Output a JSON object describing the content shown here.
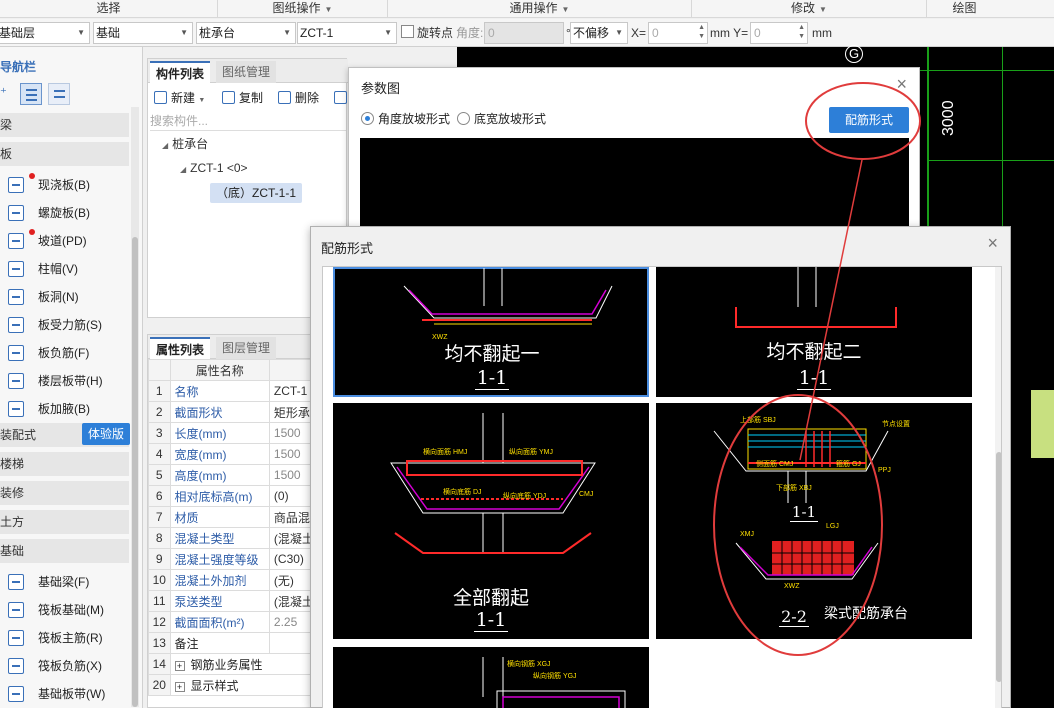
{
  "ribbon": {
    "groups": [
      "选择",
      "图纸操作",
      "通用操作",
      "修改",
      "绘图"
    ]
  },
  "selectors": {
    "floor": "基础层",
    "category": "基础",
    "type": "桩承台",
    "component": "ZCT-1",
    "rotate_label": "旋转点",
    "angle_label": "角度:",
    "angle_value": "0",
    "degree": "°",
    "offset_option": "不偏移",
    "x_label": "X=",
    "x_value": "0",
    "mm_y": "mm Y=",
    "y_value": "0",
    "mm": "mm"
  },
  "nav": {
    "title": "导航栏",
    "trial_badge": "体验版",
    "items": [
      {
        "kind": "cat",
        "label": "梁"
      },
      {
        "kind": "cat",
        "label": "板"
      },
      {
        "kind": "item",
        "label": "现浇板(B)",
        "dot": true
      },
      {
        "kind": "item",
        "label": "螺旋板(B)"
      },
      {
        "kind": "item",
        "label": "坡道(PD)",
        "dot": true
      },
      {
        "kind": "item",
        "label": "柱帽(V)"
      },
      {
        "kind": "item",
        "label": "板洞(N)"
      },
      {
        "kind": "item",
        "label": "板受力筋(S)"
      },
      {
        "kind": "item",
        "label": "板负筋(F)"
      },
      {
        "kind": "item",
        "label": "楼层板带(H)"
      },
      {
        "kind": "item",
        "label": "板加腋(B)"
      },
      {
        "kind": "cat",
        "label": "装配式"
      },
      {
        "kind": "cat",
        "label": "楼梯"
      },
      {
        "kind": "cat",
        "label": "装修"
      },
      {
        "kind": "cat",
        "label": "土方"
      },
      {
        "kind": "cat",
        "label": "基础"
      },
      {
        "kind": "item",
        "label": "基础梁(F)"
      },
      {
        "kind": "item",
        "label": "筏板基础(M)"
      },
      {
        "kind": "item",
        "label": "筏板主筋(R)"
      },
      {
        "kind": "item",
        "label": "筏板负筋(X)"
      },
      {
        "kind": "item",
        "label": "基础板带(W)"
      }
    ]
  },
  "component_panel": {
    "tab_list": "构件列表",
    "tab_drawing": "图纸管理",
    "new": "新建",
    "copy": "复制",
    "delete": "删除",
    "search_placeholder": "搜索构件...",
    "tree": [
      "桩承台",
      "ZCT-1 <0>",
      "（底）ZCT-1-1"
    ]
  },
  "property_panel": {
    "tab_props": "属性列表",
    "tab_layers": "图层管理",
    "header_name": "属性名称",
    "rows": [
      {
        "n": "1",
        "k": "名称",
        "v": "ZCT-1",
        "blue": true
      },
      {
        "n": "2",
        "k": "截面形状",
        "v": "矩形承",
        "blue": true
      },
      {
        "n": "3",
        "k": "长度(mm)",
        "v": "1500",
        "blue": true,
        "grey": true
      },
      {
        "n": "4",
        "k": "宽度(mm)",
        "v": "1500",
        "blue": true,
        "grey": true
      },
      {
        "n": "5",
        "k": "高度(mm)",
        "v": "1500",
        "blue": true,
        "grey": true
      },
      {
        "n": "6",
        "k": "相对底标高(m)",
        "v": "(0)",
        "blue": true
      },
      {
        "n": "7",
        "k": "材质",
        "v": "商品混",
        "blue": true
      },
      {
        "n": "8",
        "k": "混凝土类型",
        "v": "(混凝土",
        "blue": true
      },
      {
        "n": "9",
        "k": "混凝土强度等级",
        "v": "(C30)",
        "blue": true
      },
      {
        "n": "10",
        "k": "混凝土外加剂",
        "v": "(无)",
        "blue": true
      },
      {
        "n": "11",
        "k": "泵送类型",
        "v": "(混凝土",
        "blue": true
      },
      {
        "n": "12",
        "k": "截面面积(m²)",
        "v": "2.25",
        "blue": true,
        "grey": true
      },
      {
        "n": "13",
        "k": "备注",
        "v": ""
      },
      {
        "n": "14",
        "k": "钢筋业务属性",
        "v": "",
        "plus": true
      },
      {
        "n": "20",
        "k": "显示样式",
        "v": "",
        "plus": true
      }
    ]
  },
  "canvas": {
    "axis_label": "G",
    "dimension": "3000"
  },
  "param_dialog": {
    "title": "参数图",
    "radio_angle": "角度放坡形式",
    "radio_width": "底宽放坡形式",
    "button": "配筋形式"
  },
  "rebar_dialog": {
    "title": "配筋形式",
    "cards": [
      {
        "caption": "均不翻起一",
        "section": "1-1"
      },
      {
        "caption": "均不翻起二",
        "section": "1-1"
      },
      {
        "caption": "全部翻起",
        "section": "1-1"
      },
      {
        "caption": "梁式配筋承台",
        "section_a": "1-1",
        "section_b": "2-2"
      }
    ],
    "annotations": {
      "top_steel": "上部筋 SBJ",
      "side_steel": "侧面筋 CMJ",
      "bottom_steel": "下部筋 XBJ",
      "transverse_top": "横向面筋 HMJ",
      "longitudinal_top": "纵向面筋 YMJ",
      "transverse_bottom": "横向底筋 DJ",
      "longitudinal_bottom": "纵向底筋 YDJ",
      "stirrup": "箍筋 GJ",
      "transverse": "横向钢筋 XGJ",
      "longitudinal": "纵向钢筋 YGJ",
      "xwz": "XWZ",
      "xmj": "XMJ",
      "lgj": "LGJ",
      "cmj": "CMJ",
      "ppj": "PPJ",
      "pj": "PJ",
      "node": "节点设置"
    }
  },
  "colors": {
    "accent": "#2d7fd8",
    "annotation_red": "#e03c3c",
    "grid_green": "#19a019",
    "selected_card": "#4a8de0"
  }
}
